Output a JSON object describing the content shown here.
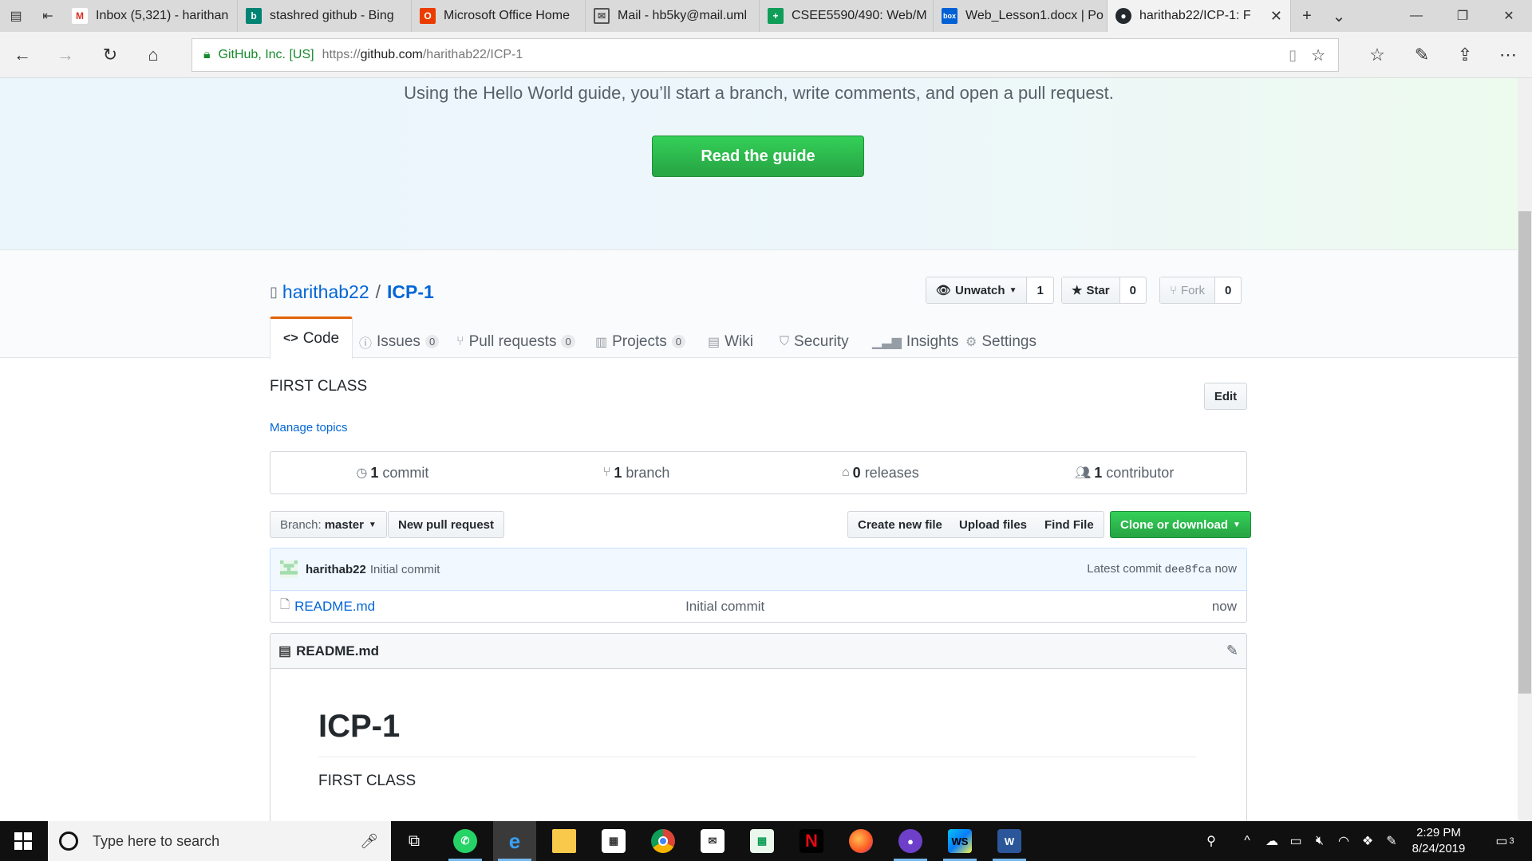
{
  "browser": {
    "tabs": [
      {
        "title": "Inbox (5,321) - harithan",
        "icon": "gmail-icon",
        "color": "#d93025"
      },
      {
        "title": "stashred github - Bing",
        "icon": "bing-icon",
        "color": "#008373"
      },
      {
        "title": "Microsoft Office Home",
        "icon": "office-icon",
        "color": "#eb3c00"
      },
      {
        "title": "Mail - hb5ky@mail.uml",
        "icon": "mail-icon",
        "color": "#555555"
      },
      {
        "title": "CSEE5590/490: Web/M",
        "icon": "sheets-icon",
        "color": "#0f9d58"
      },
      {
        "title": "Web_Lesson1.docx | Po",
        "icon": "box-icon",
        "color": "#0061d5"
      },
      {
        "title": "harithab22/ICP-1: F",
        "icon": "github-icon",
        "color": "#24292e"
      }
    ],
    "address": {
      "org": "GitHub, Inc. [US]",
      "url_prefix": "https://",
      "url_host": "github.com",
      "url_path": "/harithab22/ICP-1"
    }
  },
  "hero": {
    "text": "Using the Hello World guide, you’ll start a branch, write comments, and open a pull request.",
    "button": "Read the guide"
  },
  "repo": {
    "owner": "harithab22",
    "separator": "/",
    "name": "ICP-1",
    "watch": {
      "label": "Unwatch",
      "count": "1"
    },
    "star": {
      "label": "Star",
      "count": "0"
    },
    "fork": {
      "label": "Fork",
      "count": "0"
    },
    "tabs": {
      "code": "Code",
      "issues": "Issues",
      "issues_count": "0",
      "pulls": "Pull requests",
      "pulls_count": "0",
      "projects": "Projects",
      "projects_count": "0",
      "wiki": "Wiki",
      "security": "Security",
      "insights": "Insights",
      "settings": "Settings"
    },
    "description": "FIRST CLASS",
    "manage_topics": "Manage topics",
    "edit": "Edit",
    "summary": {
      "commits_num": "1",
      "commits_label": "commit",
      "branches_num": "1",
      "branches_label": "branch",
      "releases_num": "0",
      "releases_label": "releases",
      "contributors_num": "1",
      "contributors_label": "contributor"
    },
    "branch_prefix": "Branch:",
    "branch_name": "master",
    "new_pr": "New pull request",
    "create_file": "Create new file",
    "upload_files": "Upload files",
    "find_file": "Find File",
    "clone": "Clone or download",
    "latest_commit": {
      "author": "harithab22",
      "message": "Initial commit",
      "prefix": "Latest commit",
      "sha": "dee8fca",
      "age": "now"
    },
    "files": [
      {
        "name": "README.md",
        "message": "Initial commit",
        "age": "now"
      }
    ],
    "readme": {
      "filename": "README.md",
      "heading": "ICP-1",
      "body": "FIRST CLASS"
    }
  },
  "taskbar": {
    "search_placeholder": "Type here to search",
    "time": "2:29 PM",
    "date": "8/24/2019",
    "notifications": "3"
  }
}
